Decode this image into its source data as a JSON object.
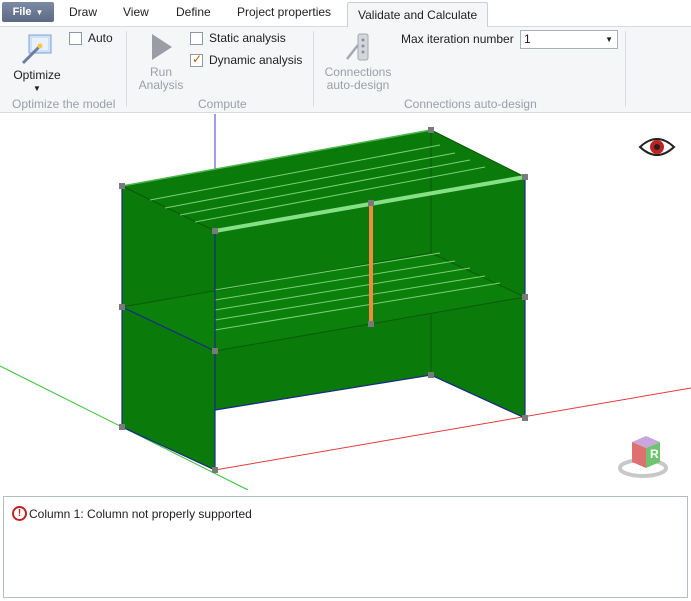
{
  "tabs": {
    "file": "File",
    "items": [
      "Draw",
      "View",
      "Define",
      "Project properties",
      "Validate and Calculate"
    ]
  },
  "ribbon": {
    "optimize": {
      "label": "Optimize",
      "auto_label": "Auto",
      "group": "Optimize the model"
    },
    "compute": {
      "run_label_1": "Run",
      "run_label_2": "Analysis",
      "static_label": "Static analysis",
      "dynamic_label": "Dynamic analysis",
      "group": "Compute"
    },
    "connections": {
      "btn_label_1": "Connections",
      "btn_label_2": "auto-design",
      "max_iter_label": "Max iteration number",
      "max_iter_value": "1",
      "group": "Connections auto-design"
    }
  },
  "viewcube": {
    "face_label": "R"
  },
  "messages": [
    {
      "text": "Column 1: Column not properly supported"
    }
  ],
  "colors": {
    "panel_green": "#0a7a0a",
    "highlight_green": "#86e086",
    "column_orange": "#f08c3c",
    "axis_red": "#e23a3a",
    "axis_green": "#2fbf2f",
    "axis_blue": "#3a3ae2"
  }
}
